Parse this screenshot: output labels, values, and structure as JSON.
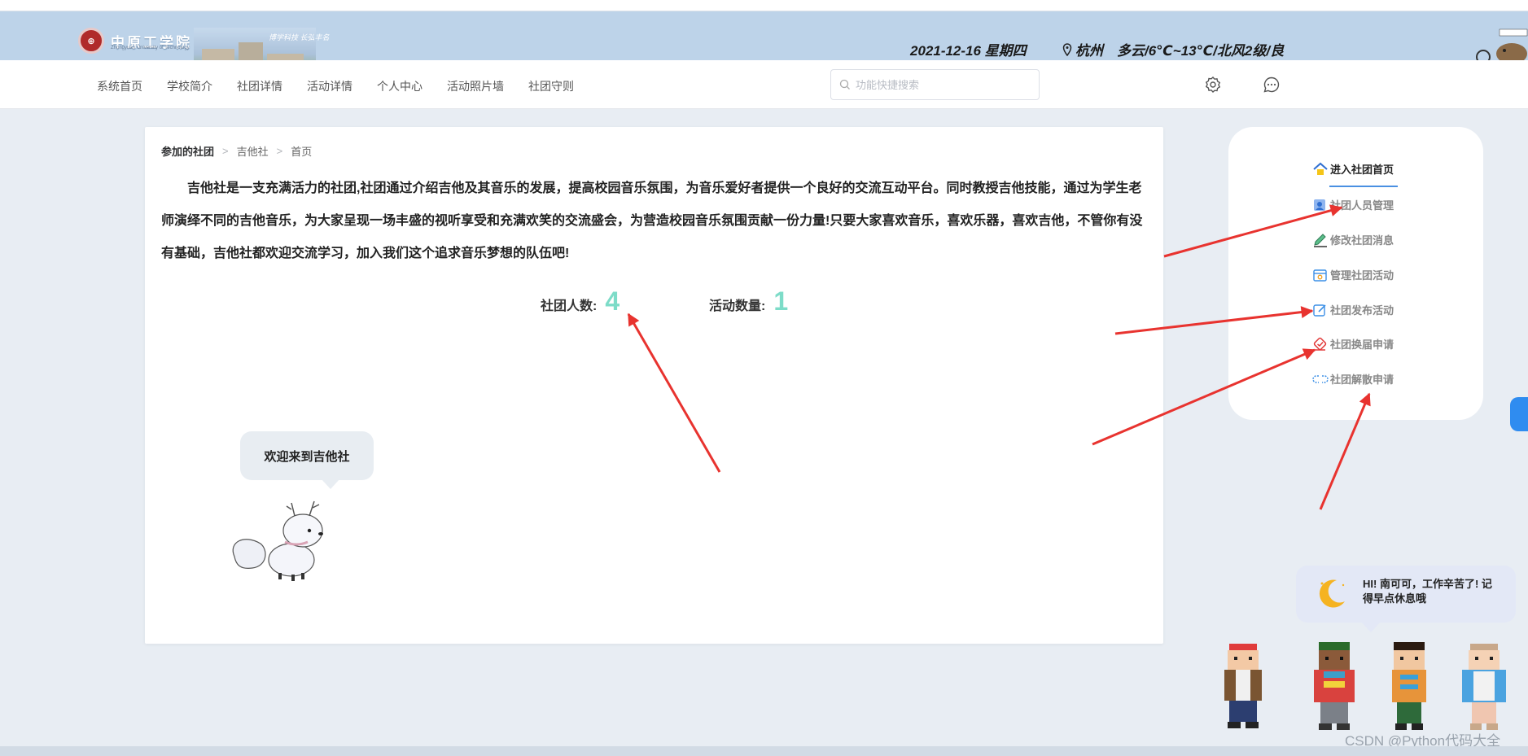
{
  "header": {
    "logo_text": "中原工学院",
    "logo_subtext": "Zhongyuan University of Technology",
    "slogan": "博学科技 长弘丰名",
    "date": "2021-12-16 星期四",
    "city": "杭州",
    "weather": "多云/6℃~13℃/北风2级/良"
  },
  "nav": {
    "items": [
      "系统首页",
      "学校简介",
      "社团详情",
      "活动详情",
      "个人中心",
      "活动照片墙",
      "社团守则"
    ],
    "search_placeholder": "功能快捷搜索"
  },
  "breadcrumb": [
    "参加的社团",
    "吉他社",
    "首页"
  ],
  "intro": "吉他社是一支充满活力的社团,社团通过介绍吉他及其音乐的发展，提高校园音乐氛围，为音乐爱好者提供一个良好的交流互动平台。同时教授吉他技能，通过为学生老师演绎不同的吉他音乐，为大家呈现一场丰盛的视听享受和充满欢笑的交流盛会，为营造校园音乐氛围贡献一份力量!只要大家喜欢音乐，喜欢乐器，喜欢吉他，不管你有没有基础，吉他社都欢迎交流学习，加入我们这个追求音乐梦想的队伍吧!",
  "stats": {
    "members_label": "社团人数:",
    "members_value": "4",
    "activities_label": "活动数量:",
    "activities_value": "1"
  },
  "mascot_bubble": "欢迎来到吉他社",
  "side_menu": {
    "items": [
      "进入社团首页",
      "社团人员管理",
      "修改社团消息",
      "管理社团活动",
      "社团发布活动",
      "社团换届申请",
      "社团解散申请"
    ]
  },
  "greeting": "HI! 南可可，工作辛苦了! 记得早点休息哦",
  "watermark": "CSDN @Python代码大全",
  "colors": {
    "banner": "#bdd3e9",
    "stat_accent": "#7ddcc8",
    "arrow": "#e8332f",
    "active_underline": "#4a90e2"
  }
}
